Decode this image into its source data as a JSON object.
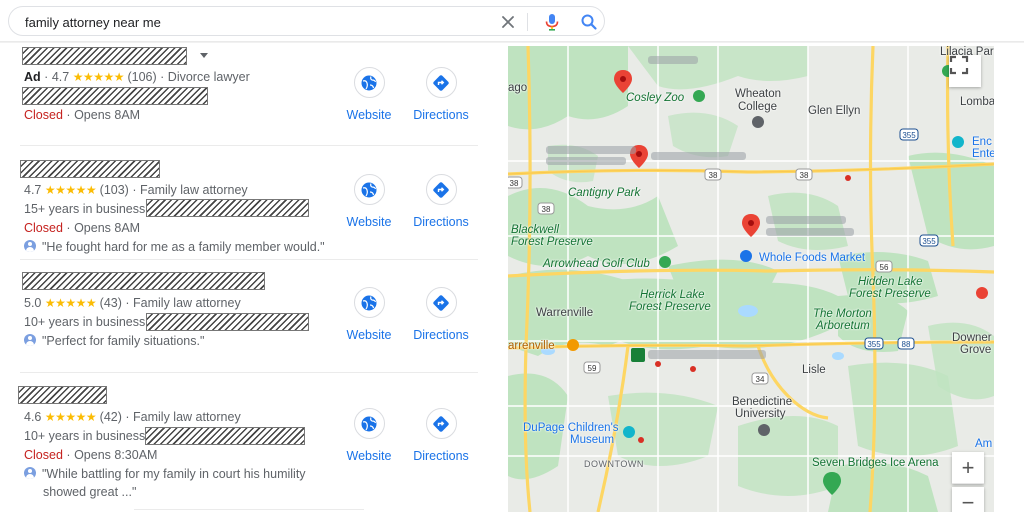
{
  "search": {
    "query": "family attorney near me",
    "clear_icon": "close-icon",
    "mic_icon": "microphone-icon",
    "search_icon": "search-icon"
  },
  "listings": [
    {
      "ad": "Ad",
      "rating": "4.7",
      "stars": "★★★★★",
      "reviews": "(106)",
      "category": "Divorce lawyer",
      "status": "Closed",
      "hours": "Opens 8AM",
      "website": "Website",
      "directions": "Directions"
    },
    {
      "rating": "4.7",
      "stars": "★★★★★",
      "reviews": "(103)",
      "category": "Family law attorney",
      "experience": "15+ years in business",
      "status": "Closed",
      "hours": "Opens 8AM",
      "review": "\"He fought hard for me as a family member would.\"",
      "website": "Website",
      "directions": "Directions"
    },
    {
      "rating": "5.0",
      "stars": "★★★★★",
      "reviews": "(43)",
      "category": "Family law attorney",
      "experience": "10+ years in business",
      "review": "\"Perfect for family situations.\"",
      "website": "Website",
      "directions": "Directions"
    },
    {
      "rating": "4.6",
      "stars": "★★★★★",
      "reviews": "(42)",
      "category": "Family law attorney",
      "experience": "10+ years in business",
      "status": "Closed",
      "hours": "Opens 8:30AM",
      "review_line1": "\"While battling for my family in court his humility",
      "review_line2": "showed great ...\"",
      "website": "Website",
      "directions": "Directions"
    }
  ],
  "separator": "·",
  "map": {
    "labels": {
      "lilacia": "Lilacia Par",
      "ago": "ago",
      "cosley_zoo": "Cosley Zoo",
      "wheaton_college_1": "Wheaton",
      "wheaton_college_2": "College",
      "glen_ellyn": "Glen Ellyn",
      "lomba": "Lomba",
      "enc_1": "Enc",
      "enc_2": "Ente",
      "cantigny": "Cantigny Park",
      "blackwell_1": "Blackwell",
      "blackwell_2": "Forest Preserve",
      "arrowhead": "Arrowhead Golf Club",
      "whole_foods": "Whole Foods Market",
      "herrick_1": "Herrick Lake",
      "herrick_2": "Forest Preserve",
      "hidden_1": "Hidden Lake",
      "hidden_2": "Forest Preserve",
      "warrenville": "Warrenville",
      "morton_1": "The Morton",
      "morton_2": "Arboretum",
      "downers_1": "Downer",
      "downers_2": "Grove",
      "warrenville2": "arrenville",
      "lisle": "Lisle",
      "benedictine_1": "Benedictine",
      "benedictine_2": "University",
      "dupage_1": "DuPage Children's",
      "dupage_2": "Museum",
      "downtown": "DOWNTOWN",
      "seven_bridges": "Seven Bridges Ice Arena",
      "am": "Am"
    },
    "route_shields": [
      "38",
      "38",
      "38",
      "355",
      "56",
      "355",
      "88",
      "34",
      "355",
      "59",
      "38"
    ],
    "fullscreen_icon": "fullscreen-icon",
    "zoom_in": "+",
    "zoom_out": "−",
    "colors": {
      "pin": "#ea4335",
      "park": "#c8e6c9",
      "road_major": "#fdd663",
      "water": "#aadaff"
    }
  }
}
